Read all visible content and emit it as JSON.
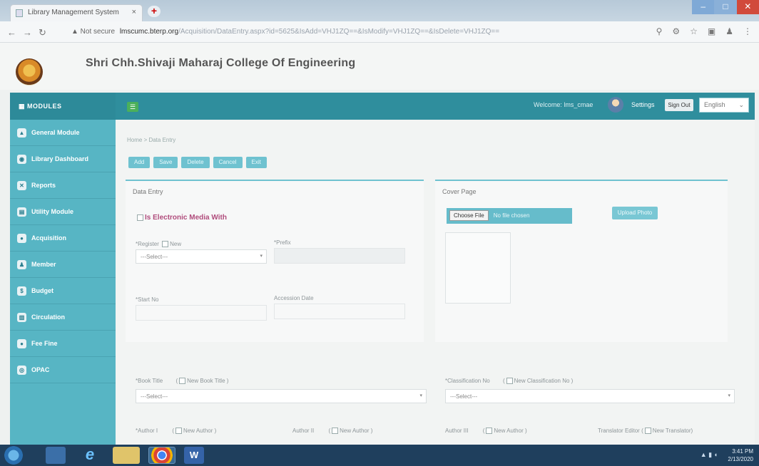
{
  "browser": {
    "tab_title": "Library Management System",
    "tab_close": "×",
    "new_tab": "+",
    "url_warning": "▲ Not secure",
    "url_host": "lmscumc.bterp.org",
    "url_path": "/Acquisition/DataEntry.aspx?id=5625&IsAdd=VHJ1ZQ==&IsModify=VHJ1ZQ==&IsDelete=VHJ1ZQ=="
  },
  "header": {
    "college_name": "Shri Chh.Shivaji Maharaj College Of Engineering"
  },
  "sidebar": {
    "heading": "MODULES",
    "items": [
      {
        "label": "General Module"
      },
      {
        "label": "Library Dashboard"
      },
      {
        "label": "Reports"
      },
      {
        "label": "Utility Module"
      },
      {
        "label": "Acquisition"
      },
      {
        "label": "Member"
      },
      {
        "label": "Budget"
      },
      {
        "label": "Circulation"
      },
      {
        "label": "Fee Fine"
      },
      {
        "label": "OPAC"
      }
    ]
  },
  "topbar": {
    "welcome": "Welcome: lms_cmae",
    "settings": "Settings",
    "signout": "Sign Out",
    "language": "English"
  },
  "main": {
    "breadcrumb": "Home > Data Entry",
    "actions": [
      "Add",
      "Save",
      "Delete",
      "Cancel",
      "Exit"
    ],
    "data_entry": {
      "title": "Data Entry",
      "electronic_media": "Is Electronic Media With",
      "register_label": "*Register",
      "new_label": "New",
      "register_value": "---Select---",
      "prefix_label": "*Prefix",
      "start_no_label": "*Start No",
      "accession_date_label": "Accession Date"
    },
    "cover_page": {
      "title": "Cover Page",
      "choose_file": "Choose File",
      "no_file": "No file chosen",
      "upload": "Upload Photo"
    },
    "book_title_label": "*Book Title",
    "new_book_title": "New Book Title",
    "book_title_value": "---Select---",
    "classification_label": "*Classification No",
    "new_classification": "New Classification No",
    "classification_value": "---Select---",
    "author1_label": "*Author I",
    "author2_label": "Author II",
    "author3_label": "Author III",
    "new_author": "New Author",
    "translator_label": "Translator Editor",
    "new_translator": "New Translator"
  },
  "taskbar": {
    "time": "3:41 PM",
    "date": "2/13/2020"
  }
}
